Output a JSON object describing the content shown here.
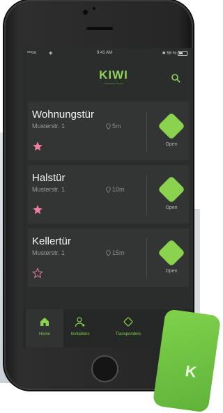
{
  "statusbar": {
    "signal": "•••oo",
    "time": "9:41 AM",
    "battery_text": "✱ 58 %"
  },
  "app": {
    "logo": "KIWI",
    "logo_tagline": "Opening Doors"
  },
  "doors": [
    {
      "name": "Wohnungstür",
      "address": "Musterstr. 1",
      "distance": "5m",
      "favorite": true,
      "action": "Open"
    },
    {
      "name": "Halstür",
      "address": "Musterstr. 1",
      "distance": "10m",
      "favorite": true,
      "action": "Open"
    },
    {
      "name": "Kellertür",
      "address": "Musterstr. 1",
      "distance": "15m",
      "favorite": false,
      "action": "Open"
    }
  ],
  "tabs": [
    {
      "label": "Home",
      "icon": "home-icon"
    },
    {
      "label": "Invitations",
      "icon": "user-add-icon"
    },
    {
      "label": "Transponders",
      "icon": "transponder-icon"
    }
  ],
  "colors": {
    "accent": "#8bd34f",
    "favorite": "#ef7fa0",
    "screen_bg": "#2b2d2c"
  }
}
